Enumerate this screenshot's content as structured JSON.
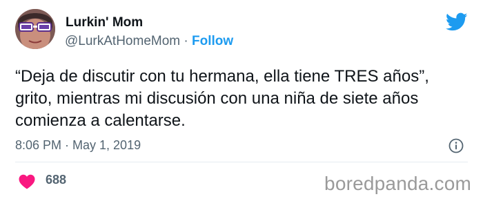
{
  "author": {
    "name": "Lurkin' Mom",
    "handle": "@LurkAtHomeMom",
    "separator": "·",
    "follow_label": "Follow"
  },
  "tweet": {
    "lines": [
      "“Deja de discutir con tu hermana, ella tiene TRES años”,",
      "grito, mientras mi discusión con una niña de siete años",
      "comienza a calentarse."
    ],
    "timestamp": "8:06 PM · May 1, 2019"
  },
  "engagement": {
    "likes": "688"
  },
  "watermark": "boredpanda.com",
  "icons": [
    "twitter-bird-icon",
    "info-icon",
    "heart-icon"
  ],
  "colors": {
    "accent": "#1d9bf0",
    "heart": "#f91880",
    "text": "#0f1419",
    "secondary": "#536471"
  }
}
